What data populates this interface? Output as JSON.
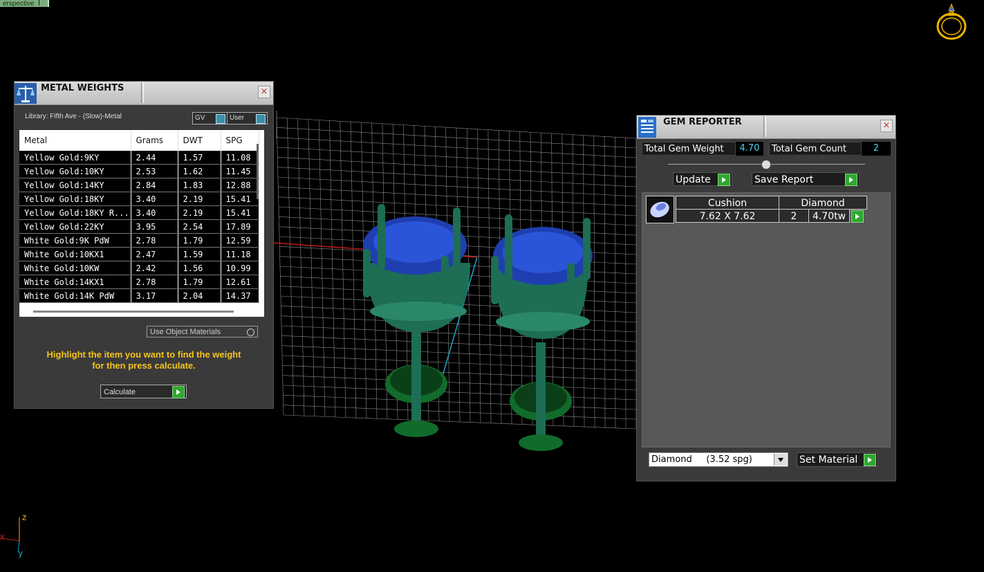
{
  "viewport": {
    "label": "erspective"
  },
  "axes": {
    "x": "x",
    "y": "y",
    "z": "z"
  },
  "metal_weights": {
    "title": "METAL WEIGHTS",
    "close": "×",
    "library_label": "Library: Fifth Ave - (Slow)-Metal",
    "toggle_gv": "GV",
    "toggle_user": "User",
    "columns": [
      "Metal",
      "Grams",
      "DWT",
      "SPG"
    ],
    "rows": [
      [
        "Yellow Gold:9KY",
        "2.44",
        "1.57",
        "11.08"
      ],
      [
        "Yellow Gold:10KY",
        "2.53",
        "1.62",
        "11.45"
      ],
      [
        "Yellow Gold:14KY",
        "2.84",
        "1.83",
        "12.88"
      ],
      [
        "Yellow Gold:18KY",
        "3.40",
        "2.19",
        "15.41"
      ],
      [
        "Yellow Gold:18KY R...",
        "3.40",
        "2.19",
        "15.41"
      ],
      [
        "Yellow Gold:22KY",
        "3.95",
        "2.54",
        "17.89"
      ],
      [
        "White Gold:9K PdW",
        "2.78",
        "1.79",
        "12.59"
      ],
      [
        "White Gold:10KX1",
        "2.47",
        "1.59",
        "11.18"
      ],
      [
        "White Gold:10KW",
        "2.42",
        "1.56",
        "10.99"
      ],
      [
        "White Gold:14KX1",
        "2.78",
        "1.79",
        "12.61"
      ],
      [
        "White Gold:14K PdW",
        "3.17",
        "2.04",
        "14.37"
      ]
    ],
    "use_object_materials": "Use Object Materials",
    "hint_line1": "Highlight the item you want to find the weight",
    "hint_line2": "for then press calculate.",
    "calculate_label": "Calculate"
  },
  "gem_reporter": {
    "title": "GEM REPORTER",
    "close": "×",
    "total_weight_label": "Total Gem Weight",
    "total_weight_value": "4.70",
    "total_count_label": "Total Gem Count",
    "total_count_value": "2",
    "update_label": "Update",
    "save_report_label": "Save Report",
    "gem": {
      "shape": "Cushion",
      "material": "Diamond",
      "size": "7.62 X 7.62",
      "count": "2",
      "weight": "4.70tw"
    },
    "material_select": "Diamond     (3.52 spg)",
    "set_material_label": "Set Material"
  },
  "colors": {
    "background": "#000000",
    "metal_green": "#1f6b3a",
    "gem_blue": "#1f3fb0",
    "hint_yellow": "#f5c518",
    "value_cyan": "#4fd3ef",
    "play_green": "#2fa82f"
  }
}
